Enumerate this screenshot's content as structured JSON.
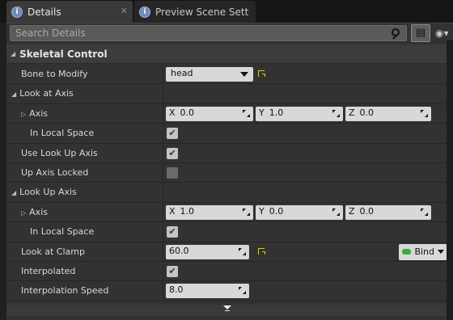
{
  "tabs": [
    {
      "label": "Details",
      "icon": "info-icon",
      "active": true
    },
    {
      "label": "Preview Scene Sett",
      "icon": "info-icon",
      "active": false
    }
  ],
  "search": {
    "placeholder": "Search Details"
  },
  "category": {
    "label": "Skeletal Control"
  },
  "rows": {
    "bone_to_modify": {
      "label": "Bone to Modify",
      "value": "head"
    },
    "look_at_axis": {
      "label": "Look at Axis"
    },
    "look_at_axis_axis": {
      "label": "Axis",
      "x": "0.0",
      "y": "1.0",
      "z": "0.0"
    },
    "look_at_local_space": {
      "label": "In Local Space",
      "checked": true
    },
    "use_look_up_axis": {
      "label": "Use Look Up Axis",
      "checked": true
    },
    "up_axis_locked": {
      "label": "Up Axis Locked",
      "checked": false
    },
    "look_up_axis": {
      "label": "Look Up Axis"
    },
    "look_up_axis_axis": {
      "label": "Axis",
      "x": "1.0",
      "y": "0.0",
      "z": "0.0"
    },
    "look_up_local_space": {
      "label": "In Local Space",
      "checked": true
    },
    "look_at_clamp": {
      "label": "Look at Clamp",
      "value": "60.0",
      "bind_label": "Bind"
    },
    "interpolated": {
      "label": "Interpolated",
      "checked": true
    },
    "interpolation_speed": {
      "label": "Interpolation Speed",
      "value": "8.0"
    }
  },
  "axis_labels": {
    "x": "X",
    "y": "Y",
    "z": "Z"
  },
  "colors": {
    "accent_reset": "#d4c84a",
    "bind_green": "#3eaa3e"
  }
}
